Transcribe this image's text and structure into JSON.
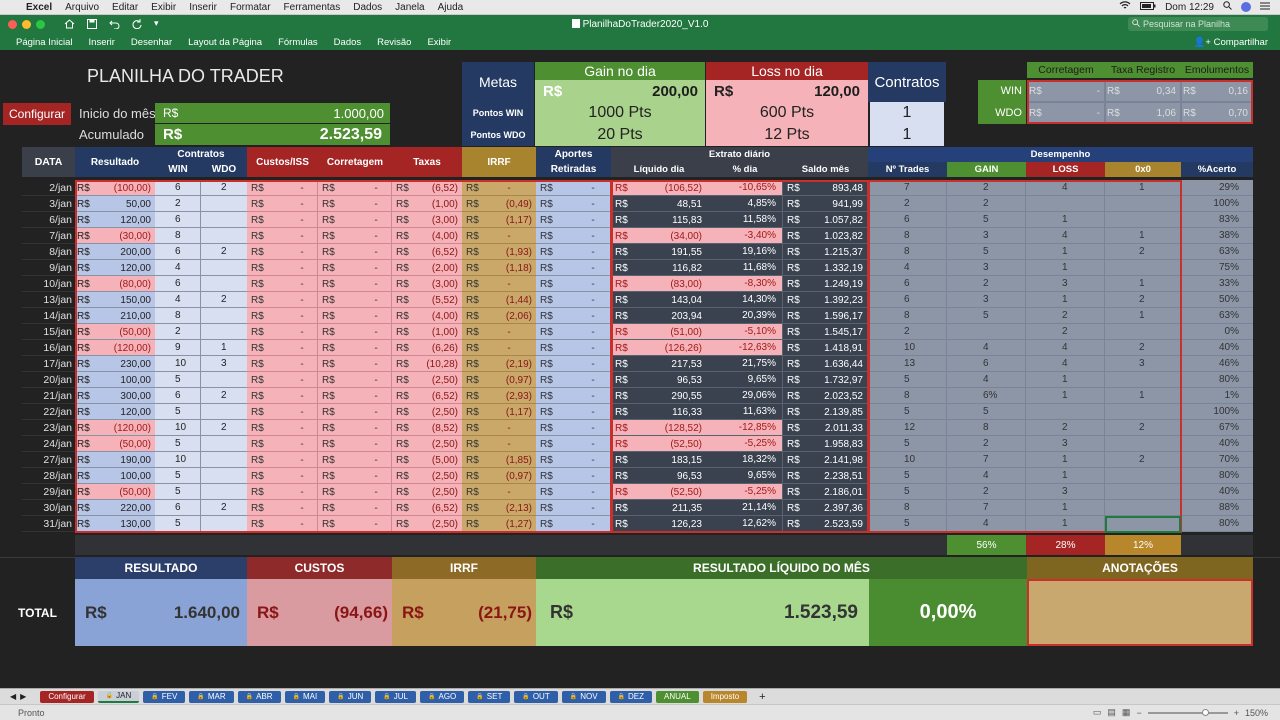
{
  "menubar": {
    "apple": "",
    "app": "Excel",
    "items": [
      "Arquivo",
      "Editar",
      "Exibir",
      "Inserir",
      "Formatar",
      "Ferramentas",
      "Dados",
      "Janela",
      "Ajuda"
    ],
    "clock": "Dom 12:29"
  },
  "window": {
    "title": "PlanilhaDoTrader2020_V1.0",
    "search_placeholder": "Pesquisar na Planilha"
  },
  "ribbon": {
    "tabs": [
      "Página Inicial",
      "Inserir",
      "Desenhar",
      "Layout da Página",
      "Fórmulas",
      "Dados",
      "Revisão",
      "Exibir"
    ],
    "share": "Compartilhar"
  },
  "header": {
    "config_label": "Configurar",
    "title": "PLANILHA DO TRADER",
    "inicio_label": "Inicio do mês",
    "inicio_cur": "R$",
    "inicio_val": "1.000,00",
    "acum_label": "Acumulado",
    "acum_cur": "R$",
    "acum_val": "2.523,59"
  },
  "metas": {
    "label": "Metas",
    "gain_label": "Gain no dia",
    "loss_label": "Loss no dia",
    "contratos_label": "Contratos",
    "gain_cur": "R$",
    "gain_val": "200,00",
    "loss_cur": "R$",
    "loss_val": "120,00",
    "pontos_win_label": "Pontos WIN",
    "pontos_wdo_label": "Pontos WDO",
    "gain_win": "1000 Pts",
    "gain_wdo": "20 Pts",
    "loss_win": "600 Pts",
    "loss_wdo": "12 Pts",
    "contratos_win": "1",
    "contratos_wdo": "1"
  },
  "fees": {
    "headers": [
      "Corretagem",
      "Taxa Registro",
      "Emolumentos"
    ],
    "rows": [
      {
        "label": "WIN",
        "vals": [
          "R$",
          "-",
          "R$",
          "0,34",
          "R$",
          "0,16"
        ]
      },
      {
        "label": "WDO",
        "vals": [
          "R$",
          "-",
          "R$",
          "1,06",
          "R$",
          "0,70"
        ]
      }
    ]
  },
  "table": {
    "h_data": "DATA",
    "h_resultado": "Resultado",
    "h_contratos": "Contratos",
    "h_win": "WIN",
    "h_wdo": "WDO",
    "h_custos": "Custos/ISS",
    "h_corretagem": "Corretagem",
    "h_taxas": "Taxas",
    "h_irrf": "IRRF",
    "h_aportes": "Aportes",
    "h_retiradas": "Retiradas",
    "h_extrato": "Extrato diário",
    "h_liquido": "Líquido dia",
    "h_pct": "% dia",
    "h_saldo": "Saldo mês",
    "h_desempenho": "Desempenho",
    "h_ntrades": "Nº Trades",
    "h_gain": "GAIN",
    "h_loss": "LOSS",
    "h_zero": "0x0",
    "h_acerto": "%Acerto",
    "cur": "R$",
    "dash": "-",
    "rows": [
      {
        "d": "2/jan",
        "res": "(100,00)",
        "win": "6",
        "wdo": "2",
        "tax": "(6,52)",
        "irrf": "-",
        "liq": "(106,52)",
        "pct": "-10,65%",
        "saldo": "893,48",
        "nt": "7",
        "g": "2",
        "l": "4",
        "z": "1",
        "ac": "29%"
      },
      {
        "d": "3/jan",
        "res": "50,00",
        "win": "2",
        "wdo": "",
        "tax": "(1,00)",
        "irrf": "(0,49)",
        "liq": "48,51",
        "pct": "4,85%",
        "saldo": "941,99",
        "nt": "2",
        "g": "2",
        "l": "",
        "z": "",
        "ac": "100%"
      },
      {
        "d": "6/jan",
        "res": "120,00",
        "win": "6",
        "wdo": "",
        "tax": "(3,00)",
        "irrf": "(1,17)",
        "liq": "115,83",
        "pct": "11,58%",
        "saldo": "1.057,82",
        "nt": "6",
        "g": "5",
        "l": "1",
        "z": "",
        "ac": "83%"
      },
      {
        "d": "7/jan",
        "res": "(30,00)",
        "win": "8",
        "wdo": "",
        "tax": "(4,00)",
        "irrf": "-",
        "liq": "(34,00)",
        "pct": "-3,40%",
        "saldo": "1.023,82",
        "nt": "8",
        "g": "3",
        "l": "4",
        "z": "1",
        "ac": "38%"
      },
      {
        "d": "8/jan",
        "res": "200,00",
        "win": "6",
        "wdo": "2",
        "tax": "(6,52)",
        "irrf": "(1,93)",
        "liq": "191,55",
        "pct": "19,16%",
        "saldo": "1.215,37",
        "nt": "8",
        "g": "5",
        "l": "1",
        "z": "2",
        "ac": "63%"
      },
      {
        "d": "9/jan",
        "res": "120,00",
        "win": "4",
        "wdo": "",
        "tax": "(2,00)",
        "irrf": "(1,18)",
        "liq": "116,82",
        "pct": "11,68%",
        "saldo": "1.332,19",
        "nt": "4",
        "g": "3",
        "l": "1",
        "z": "",
        "ac": "75%"
      },
      {
        "d": "10/jan",
        "res": "(80,00)",
        "win": "6",
        "wdo": "",
        "tax": "(3,00)",
        "irrf": "-",
        "liq": "(83,00)",
        "pct": "-8,30%",
        "saldo": "1.249,19",
        "nt": "6",
        "g": "2",
        "l": "3",
        "z": "1",
        "ac": "33%"
      },
      {
        "d": "13/jan",
        "res": "150,00",
        "win": "4",
        "wdo": "2",
        "tax": "(5,52)",
        "irrf": "(1,44)",
        "liq": "143,04",
        "pct": "14,30%",
        "saldo": "1.392,23",
        "nt": "6",
        "g": "3",
        "l": "1",
        "z": "2",
        "ac": "50%"
      },
      {
        "d": "14/jan",
        "res": "210,00",
        "win": "8",
        "wdo": "",
        "tax": "(4,00)",
        "irrf": "(2,06)",
        "liq": "203,94",
        "pct": "20,39%",
        "saldo": "1.596,17",
        "nt": "8",
        "g": "5",
        "l": "2",
        "z": "1",
        "ac": "63%"
      },
      {
        "d": "15/jan",
        "res": "(50,00)",
        "win": "2",
        "wdo": "",
        "tax": "(1,00)",
        "irrf": "-",
        "liq": "(51,00)",
        "pct": "-5,10%",
        "saldo": "1.545,17",
        "nt": "2",
        "g": "",
        "l": "2",
        "z": "",
        "ac": "0%"
      },
      {
        "d": "16/jan",
        "res": "(120,00)",
        "win": "9",
        "wdo": "1",
        "tax": "(6,26)",
        "irrf": "-",
        "liq": "(126,26)",
        "pct": "-12,63%",
        "saldo": "1.418,91",
        "nt": "10",
        "g": "4",
        "l": "4",
        "z": "2",
        "ac": "40%"
      },
      {
        "d": "17/jan",
        "res": "230,00",
        "win": "10",
        "wdo": "3",
        "tax": "(10,28)",
        "irrf": "(2,19)",
        "liq": "217,53",
        "pct": "21,75%",
        "saldo": "1.636,44",
        "nt": "13",
        "g": "6",
        "l": "4",
        "z": "3",
        "ac": "46%"
      },
      {
        "d": "20/jan",
        "res": "100,00",
        "win": "5",
        "wdo": "",
        "tax": "(2,50)",
        "irrf": "(0,97)",
        "liq": "96,53",
        "pct": "9,65%",
        "saldo": "1.732,97",
        "nt": "5",
        "g": "4",
        "l": "1",
        "z": "",
        "ac": "80%"
      },
      {
        "d": "21/jan",
        "res": "300,00",
        "win": "6",
        "wdo": "2",
        "tax": "(6,52)",
        "irrf": "(2,93)",
        "liq": "290,55",
        "pct": "29,06%",
        "saldo": "2.023,52",
        "nt": "8",
        "g": "6%",
        "l": "1",
        "z": "1",
        "ac": "1%"
      },
      {
        "d": "22/jan",
        "res": "120,00",
        "win": "5",
        "wdo": "",
        "tax": "(2,50)",
        "irrf": "(1,17)",
        "liq": "116,33",
        "pct": "11,63%",
        "saldo": "2.139,85",
        "nt": "5",
        "g": "5",
        "l": "",
        "z": "",
        "ac": "100%"
      },
      {
        "d": "23/jan",
        "res": "(120,00)",
        "win": "10",
        "wdo": "2",
        "tax": "(8,52)",
        "irrf": "-",
        "liq": "(128,52)",
        "pct": "-12,85%",
        "saldo": "2.011,33",
        "nt": "12",
        "g": "8",
        "l": "2",
        "z": "2",
        "ac": "67%"
      },
      {
        "d": "24/jan",
        "res": "(50,00)",
        "win": "5",
        "wdo": "",
        "tax": "(2,50)",
        "irrf": "-",
        "liq": "(52,50)",
        "pct": "-5,25%",
        "saldo": "1.958,83",
        "nt": "5",
        "g": "2",
        "l": "3",
        "z": "",
        "ac": "40%"
      },
      {
        "d": "27/jan",
        "res": "190,00",
        "win": "10",
        "wdo": "",
        "tax": "(5,00)",
        "irrf": "(1,85)",
        "liq": "183,15",
        "pct": "18,32%",
        "saldo": "2.141,98",
        "nt": "10",
        "g": "7",
        "l": "1",
        "z": "2",
        "ac": "70%"
      },
      {
        "d": "28/jan",
        "res": "100,00",
        "win": "5",
        "wdo": "",
        "tax": "(2,50)",
        "irrf": "(0,97)",
        "liq": "96,53",
        "pct": "9,65%",
        "saldo": "2.238,51",
        "nt": "5",
        "g": "4",
        "l": "1",
        "z": "",
        "ac": "80%"
      },
      {
        "d": "29/jan",
        "res": "(50,00)",
        "win": "5",
        "wdo": "",
        "tax": "(2,50)",
        "irrf": "-",
        "liq": "(52,50)",
        "pct": "-5,25%",
        "saldo": "2.186,01",
        "nt": "5",
        "g": "2",
        "l": "3",
        "z": "",
        "ac": "40%"
      },
      {
        "d": "30/jan",
        "res": "220,00",
        "win": "6",
        "wdo": "2",
        "tax": "(6,52)",
        "irrf": "(2,13)",
        "liq": "211,35",
        "pct": "21,14%",
        "saldo": "2.397,36",
        "nt": "8",
        "g": "7",
        "l": "1",
        "z": "",
        "ac": "88%"
      },
      {
        "d": "31/jan",
        "res": "130,00",
        "win": "5",
        "wdo": "",
        "tax": "(2,50)",
        "irrf": "(1,27)",
        "liq": "126,23",
        "pct": "12,62%",
        "saldo": "2.523,59",
        "nt": "5",
        "g": "4",
        "l": "1",
        "z": "",
        "ac": "80%"
      }
    ],
    "sum_gain": "56%",
    "sum_loss": "28%",
    "sum_zero": "12%"
  },
  "totals": {
    "label": "TOTAL",
    "resultado_h": "RESULTADO",
    "custos_h": "CUSTOS",
    "irrf_h": "IRRF",
    "liquido_h": "RESULTADO LÍQUIDO DO MÊS",
    "anot_h": "ANOTAÇÕES",
    "cur": "R$",
    "resultado": "1.640,00",
    "custos": "(94,66)",
    "irrf": "(21,75)",
    "liquido": "1.523,59",
    "pct": "0,00%"
  },
  "sheets": [
    "Configurar",
    "JAN",
    "FEV",
    "MAR",
    "ABR",
    "MAI",
    "JUN",
    "JUL",
    "AGO",
    "SET",
    "OUT",
    "NOV",
    "DEZ",
    "ANUAL",
    "Imposto"
  ],
  "status": {
    "left": "Pronto",
    "zoom": "150%"
  }
}
